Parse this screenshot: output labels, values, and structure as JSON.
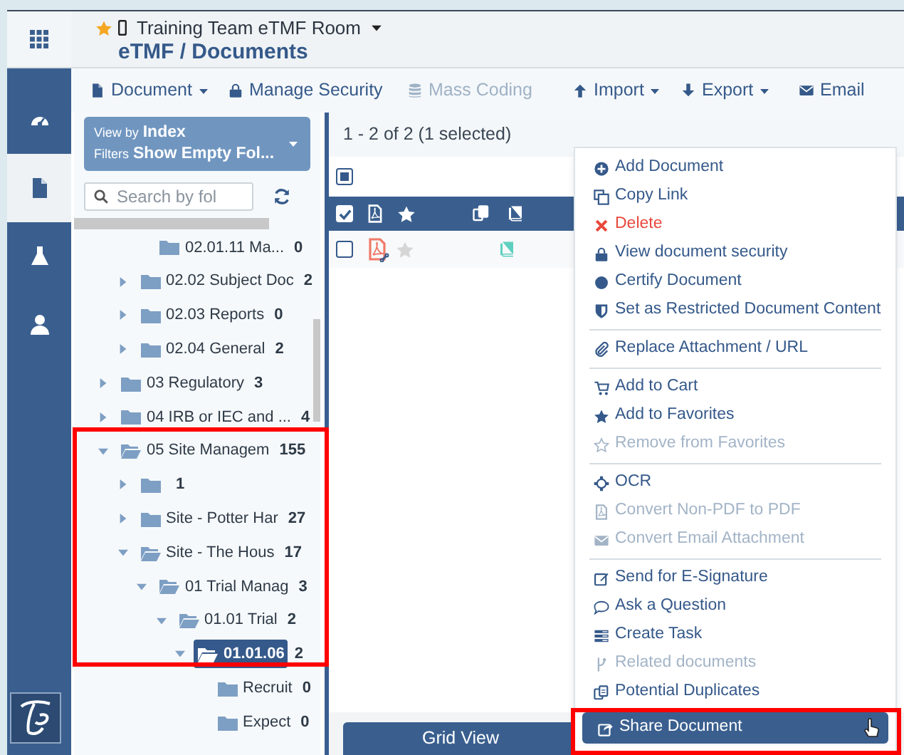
{
  "header": {
    "room": "Training Team eTMF Room",
    "favorite": true,
    "breadcrumb": "eTMF / Documents"
  },
  "rail": [
    {
      "selected": false
    },
    {
      "selected": true
    },
    {
      "selected": false
    },
    {
      "selected": false
    }
  ],
  "toolbar": [
    {
      "label": "Document",
      "caret": true,
      "disabled": false
    },
    {
      "label": "Manage Security",
      "caret": false,
      "disabled": false
    },
    {
      "label": "Mass Coding",
      "caret": false,
      "disabled": true
    },
    {
      "label": "Import",
      "caret": true,
      "disabled": false
    },
    {
      "label": "Export",
      "caret": true,
      "disabled": false
    },
    {
      "label": "Email",
      "caret": false,
      "disabled": false
    }
  ],
  "filter": {
    "view_by_label": "View by",
    "view_by": "Index",
    "filters_label": "Filters",
    "filters": "Show Empty Fol..."
  },
  "search": {
    "placeholder": "Search by fol"
  },
  "tree": [
    {
      "kind": "hidden",
      "children": [
        {
          "kind": "hidden",
          "children": [
            {
              "kind": "leaf",
              "label": "02.01.11 Ma...",
              "count": "0",
              "selected": false
            }
          ]
        },
        {
          "kind": "branch",
          "label": "02.02 Subject Doc",
          "count": "2",
          "expanded": false,
          "selected": false
        },
        {
          "kind": "branch",
          "label": "02.03 Reports",
          "count": "0",
          "expanded": false,
          "selected": false
        },
        {
          "kind": "branch",
          "label": "02.04 General",
          "count": "2",
          "expanded": false,
          "selected": false
        }
      ]
    },
    {
      "kind": "branch",
      "label": "03 Regulatory",
      "count": "3",
      "expanded": false,
      "selected": false
    },
    {
      "kind": "branch",
      "label": "04 IRB or IEC and ...",
      "count": "4",
      "expanded": false,
      "selected": false
    },
    {
      "kind": "branch",
      "label": "05 Site Managem",
      "count": "155",
      "expanded": true,
      "selected": false,
      "children": [
        {
          "kind": "branch",
          "count": "1",
          "expanded": false,
          "selected": false
        },
        {
          "kind": "branch",
          "label": "Site - Potter Har",
          "count": "27",
          "expanded": false,
          "selected": false
        },
        {
          "kind": "branch",
          "label": "Site - The Hous",
          "count": "17",
          "expanded": true,
          "selected": false,
          "children": [
            {
              "kind": "branch",
              "label": "01 Trial Manag",
              "count": "3",
              "expanded": true,
              "selected": false,
              "children": [
                {
                  "kind": "branch",
                  "label": "01.01 Trial",
                  "count": "2",
                  "expanded": true,
                  "selected": false,
                  "children": [
                    {
                      "kind": "branch",
                      "label": "01.01.06",
                      "count": "2",
                      "expanded": true,
                      "selected": true,
                      "children": [
                        {
                          "kind": "leaf",
                          "label": "Recruit",
                          "count": "0",
                          "selected": false
                        },
                        {
                          "kind": "leaf",
                          "label": "Expect",
                          "count": "0",
                          "selected": false
                        }
                      ]
                    }
                  ]
                }
              ]
            }
          ]
        }
      ]
    }
  ],
  "results": "1 - 2 of 2 (1 selected)",
  "table": {
    "select_all_indeterminate": true,
    "header_checked": true,
    "rows": [
      {
        "checked": false,
        "favorite": false
      }
    ]
  },
  "grid_view": "Grid View",
  "menu": [
    {
      "kind": "action",
      "label": "Add Document",
      "disabled": false,
      "selected": false
    },
    {
      "kind": "action",
      "label": "Copy Link",
      "disabled": false,
      "selected": false
    },
    {
      "kind": "danger",
      "label": "Delete",
      "disabled": false,
      "selected": false
    },
    {
      "kind": "action",
      "label": "View document security",
      "disabled": false,
      "selected": false
    },
    {
      "kind": "action",
      "label": "Certify Document",
      "disabled": false,
      "selected": false
    },
    {
      "kind": "action",
      "label": "Set as Restricted Document Content",
      "disabled": false,
      "selected": false
    },
    {
      "kind": "divider"
    },
    {
      "kind": "action",
      "label": "Replace Attachment / URL",
      "disabled": false,
      "selected": false
    },
    {
      "kind": "divider"
    },
    {
      "kind": "action",
      "label": "Add to Cart",
      "disabled": false,
      "selected": false
    },
    {
      "kind": "action",
      "label": "Add to Favorites",
      "disabled": false,
      "selected": false
    },
    {
      "kind": "action",
      "label": "Remove from Favorites",
      "disabled": true,
      "selected": false
    },
    {
      "kind": "divider"
    },
    {
      "kind": "action",
      "label": "OCR",
      "disabled": false,
      "selected": false
    },
    {
      "kind": "action",
      "label": "Convert Non-PDF to PDF",
      "disabled": true,
      "selected": false
    },
    {
      "kind": "action",
      "label": "Convert Email Attachment",
      "disabled": true,
      "selected": false
    },
    {
      "kind": "divider"
    },
    {
      "kind": "action",
      "label": "Send for E-Signature",
      "disabled": false,
      "selected": false
    },
    {
      "kind": "action",
      "label": "Ask a Question",
      "disabled": false,
      "selected": false
    },
    {
      "kind": "action",
      "label": "Create Task",
      "disabled": false,
      "selected": false
    },
    {
      "kind": "action",
      "label": "Related documents",
      "disabled": true,
      "selected": false
    },
    {
      "kind": "action",
      "label": "Potential Duplicates",
      "disabled": false,
      "selected": false
    },
    {
      "kind": "action",
      "label": "Share Document",
      "disabled": false,
      "selected": true
    }
  ]
}
